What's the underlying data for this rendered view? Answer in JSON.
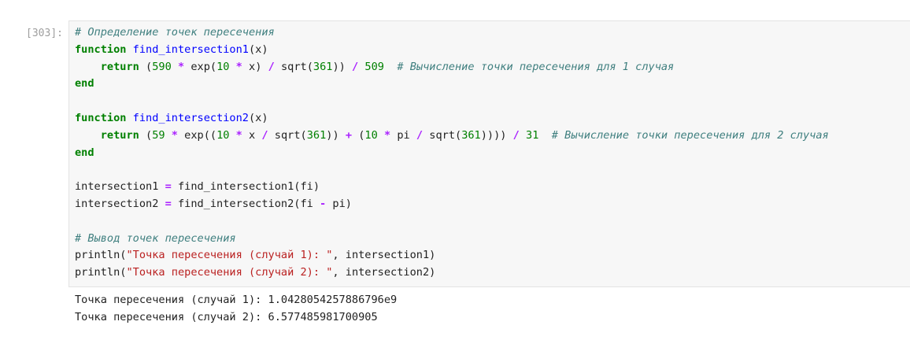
{
  "cell": {
    "prompt": "[303]:",
    "code_lines": [
      [
        {
          "t": "comment",
          "v": "# Определение точек пересечения"
        }
      ],
      [
        {
          "t": "keyword",
          "v": "function"
        },
        {
          "t": "plain",
          "v": " "
        },
        {
          "t": "def",
          "v": "find_intersection1"
        },
        {
          "t": "plain",
          "v": "(x)"
        }
      ],
      [
        {
          "t": "plain",
          "v": "    "
        },
        {
          "t": "keyword",
          "v": "return"
        },
        {
          "t": "plain",
          "v": " ("
        },
        {
          "t": "number",
          "v": "590"
        },
        {
          "t": "plain",
          "v": " "
        },
        {
          "t": "operator",
          "v": "*"
        },
        {
          "t": "plain",
          "v": " exp("
        },
        {
          "t": "number",
          "v": "10"
        },
        {
          "t": "plain",
          "v": " "
        },
        {
          "t": "operator",
          "v": "*"
        },
        {
          "t": "plain",
          "v": " x) "
        },
        {
          "t": "operator",
          "v": "/"
        },
        {
          "t": "plain",
          "v": " sqrt("
        },
        {
          "t": "number",
          "v": "361"
        },
        {
          "t": "plain",
          "v": ")) "
        },
        {
          "t": "operator",
          "v": "/"
        },
        {
          "t": "plain",
          "v": " "
        },
        {
          "t": "number",
          "v": "509"
        },
        {
          "t": "plain",
          "v": "  "
        },
        {
          "t": "comment",
          "v": "# Вычисление точки пересечения для 1 случая"
        }
      ],
      [
        {
          "t": "keyword",
          "v": "end"
        }
      ],
      [
        {
          "t": "plain",
          "v": ""
        }
      ],
      [
        {
          "t": "keyword",
          "v": "function"
        },
        {
          "t": "plain",
          "v": " "
        },
        {
          "t": "def",
          "v": "find_intersection2"
        },
        {
          "t": "plain",
          "v": "(x)"
        }
      ],
      [
        {
          "t": "plain",
          "v": "    "
        },
        {
          "t": "keyword",
          "v": "return"
        },
        {
          "t": "plain",
          "v": " ("
        },
        {
          "t": "number",
          "v": "59"
        },
        {
          "t": "plain",
          "v": " "
        },
        {
          "t": "operator",
          "v": "*"
        },
        {
          "t": "plain",
          "v": " exp(("
        },
        {
          "t": "number",
          "v": "10"
        },
        {
          "t": "plain",
          "v": " "
        },
        {
          "t": "operator",
          "v": "*"
        },
        {
          "t": "plain",
          "v": " x "
        },
        {
          "t": "operator",
          "v": "/"
        },
        {
          "t": "plain",
          "v": " sqrt("
        },
        {
          "t": "number",
          "v": "361"
        },
        {
          "t": "plain",
          "v": ")) "
        },
        {
          "t": "operator",
          "v": "+"
        },
        {
          "t": "plain",
          "v": " ("
        },
        {
          "t": "number",
          "v": "10"
        },
        {
          "t": "plain",
          "v": " "
        },
        {
          "t": "operator",
          "v": "*"
        },
        {
          "t": "plain",
          "v": " pi "
        },
        {
          "t": "operator",
          "v": "/"
        },
        {
          "t": "plain",
          "v": " sqrt("
        },
        {
          "t": "number",
          "v": "361"
        },
        {
          "t": "plain",
          "v": ")))) "
        },
        {
          "t": "operator",
          "v": "/"
        },
        {
          "t": "plain",
          "v": " "
        },
        {
          "t": "number",
          "v": "31"
        },
        {
          "t": "plain",
          "v": "  "
        },
        {
          "t": "comment",
          "v": "# Вычисление точки пересечения для 2 случая"
        }
      ],
      [
        {
          "t": "keyword",
          "v": "end"
        }
      ],
      [
        {
          "t": "plain",
          "v": ""
        }
      ],
      [
        {
          "t": "plain",
          "v": "intersection1 "
        },
        {
          "t": "operator",
          "v": "="
        },
        {
          "t": "plain",
          "v": " find_intersection1(fi)"
        }
      ],
      [
        {
          "t": "plain",
          "v": "intersection2 "
        },
        {
          "t": "operator",
          "v": "="
        },
        {
          "t": "plain",
          "v": " find_intersection2(fi "
        },
        {
          "t": "operator",
          "v": "-"
        },
        {
          "t": "plain",
          "v": " pi)"
        }
      ],
      [
        {
          "t": "plain",
          "v": ""
        }
      ],
      [
        {
          "t": "comment",
          "v": "# Вывод точек пересечения"
        }
      ],
      [
        {
          "t": "plain",
          "v": "println("
        },
        {
          "t": "string",
          "v": "\"Точка пересечения (случай 1): \""
        },
        {
          "t": "plain",
          "v": ", intersection1)"
        }
      ],
      [
        {
          "t": "plain",
          "v": "println("
        },
        {
          "t": "string",
          "v": "\"Точка пересечения (случай 2): \""
        },
        {
          "t": "plain",
          "v": ", intersection2)"
        }
      ]
    ],
    "output_lines": [
      "Точка пересечения (случай 1): 1.0428054257886796e9",
      "Точка пересечения (случай 2): 6.577485981700905"
    ]
  },
  "colors": {
    "comment": "#3f7f7f",
    "keyword": "#008000",
    "def": "#0000ff",
    "number": "#008000",
    "operator": "#aa22ff",
    "string": "#ba2121",
    "plain": "#212121",
    "prompt": "#9e9e9e",
    "input_background": "#f7f7f7",
    "input_border": "#e3e3e3"
  }
}
